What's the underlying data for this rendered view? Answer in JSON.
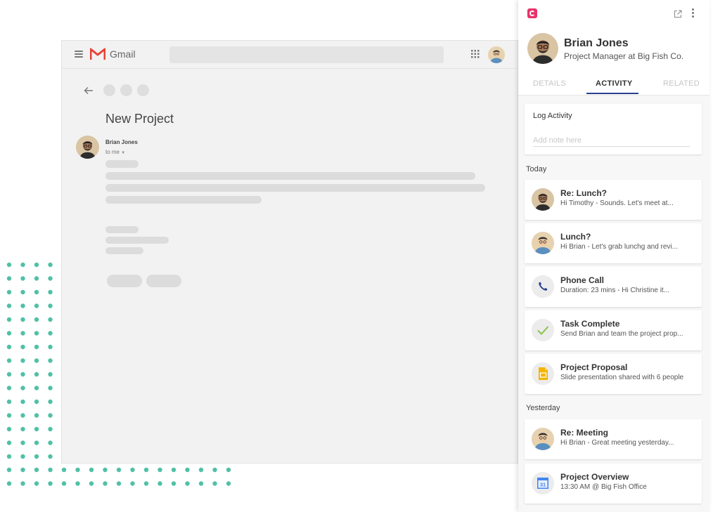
{
  "colors": {
    "dots": "#4fc1a6",
    "brand": "#e8336b",
    "tab_active": "#2a3f8f"
  },
  "gmail": {
    "app_name": "Gmail",
    "subject": "New Project",
    "sender": "Brian Jones",
    "recipient": "to me"
  },
  "panel": {
    "contact_name": "Brian Jones",
    "contact_title": "Project Manager at Big Fish Co.",
    "tabs": [
      {
        "label": "DETAILS",
        "active": false
      },
      {
        "label": "ACTIVITY",
        "active": true
      },
      {
        "label": "RELATED",
        "active": false
      }
    ],
    "log": {
      "title": "Log Activity",
      "placeholder": "Add note here"
    },
    "sections": {
      "today": "Today",
      "yesterday": "Yesterday"
    },
    "today_items": [
      {
        "title": "Re: Lunch?",
        "subtitle": "Hi Timothy - Sounds. Let's meet at...",
        "icon": "brian-avatar"
      },
      {
        "title": "Lunch?",
        "subtitle": "Hi Brian - Let's grab lunchg and revi...",
        "icon": "timothy-avatar"
      },
      {
        "title": "Phone Call",
        "subtitle": "Duration: 23 mins - Hi Christine it...",
        "icon": "phone-icon"
      },
      {
        "title": "Task Complete",
        "subtitle": "Send Brian and team the project prop...",
        "icon": "check-icon"
      },
      {
        "title": "Project Proposal",
        "subtitle": "Slide presentation shared with 6 people",
        "icon": "slides-icon"
      }
    ],
    "yesterday_items": [
      {
        "title": "Re: Meeting",
        "subtitle": "Hi Brian - Great meeting yesterday...",
        "icon": "timothy-avatar"
      },
      {
        "title": "Project Overview",
        "subtitle": "13:30 AM @ Big Fish Office",
        "icon": "calendar-icon",
        "calendar_day": "31"
      }
    ]
  }
}
